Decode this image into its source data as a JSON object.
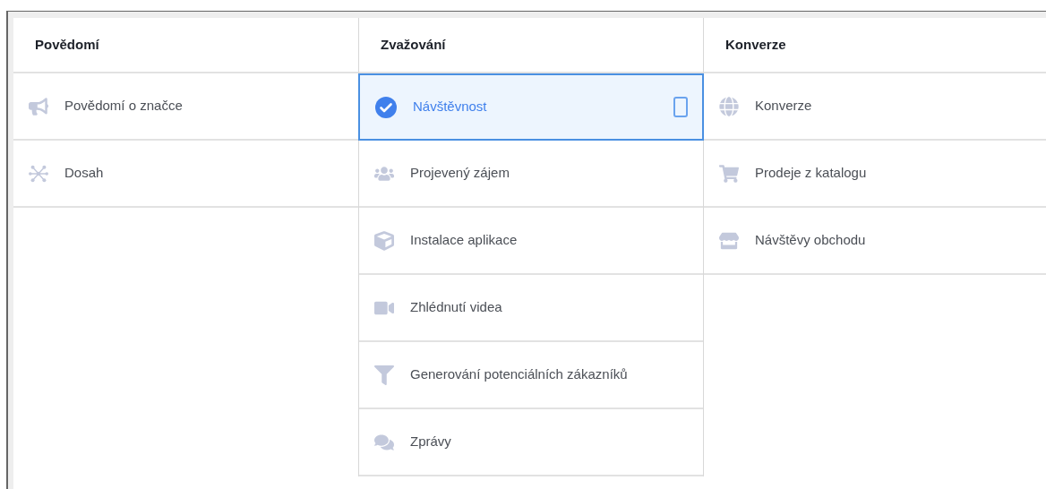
{
  "columns": [
    {
      "title": "Povědomí",
      "items": [
        {
          "label": "Povědomí o značce",
          "kind": "megaphone",
          "selected": false
        },
        {
          "label": "Dosah",
          "kind": "hub",
          "selected": false
        }
      ]
    },
    {
      "title": "Zvažování",
      "items": [
        {
          "label": "Návštěvnost",
          "kind": "check",
          "selected": true
        },
        {
          "label": "Projevený zájem",
          "kind": "people",
          "selected": false
        },
        {
          "label": "Instalace aplikace",
          "kind": "cube",
          "selected": false
        },
        {
          "label": "Zhlédnutí videa",
          "kind": "video",
          "selected": false
        },
        {
          "label": "Generování potenciálních zákazníků",
          "kind": "funnel",
          "selected": false
        },
        {
          "label": "Zprávy",
          "kind": "chat",
          "selected": false
        }
      ]
    },
    {
      "title": "Konverze",
      "items": [
        {
          "label": "Konverze",
          "kind": "globe",
          "selected": false
        },
        {
          "label": "Prodeje z katalogu",
          "kind": "cart",
          "selected": false
        },
        {
          "label": "Návštěvy obchodu",
          "kind": "store",
          "selected": false
        }
      ]
    }
  ]
}
